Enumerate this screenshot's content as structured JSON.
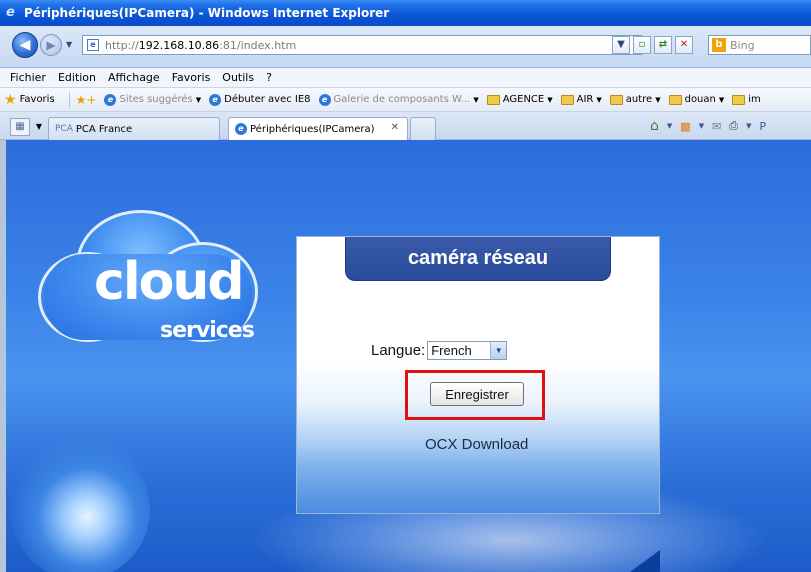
{
  "window": {
    "title": "Périphériques(IPCamera) - Windows Internet Explorer"
  },
  "address_bar": {
    "url_prefix": "http://",
    "url_host": "192.168.10.86",
    "url_suffix": ":81/index.htm",
    "search_placeholder": "Bing"
  },
  "menu": {
    "items": [
      "Fichier",
      "Edition",
      "Affichage",
      "Favoris",
      "Outils",
      "?"
    ]
  },
  "favorites_bar": {
    "favorites_label": "Favoris",
    "items": [
      {
        "label": "Sites suggérés",
        "dropdown": true,
        "muted": true
      },
      {
        "label": "Débuter avec IE8",
        "dropdown": false,
        "muted": false
      },
      {
        "label": "Galerie de composants W...",
        "dropdown": true,
        "muted": true
      },
      {
        "label": "AGENCE",
        "dropdown": true,
        "folder": true
      },
      {
        "label": "AIR",
        "dropdown": true,
        "folder": true
      },
      {
        "label": "autre",
        "dropdown": true,
        "folder": true
      },
      {
        "label": "douan",
        "dropdown": true,
        "folder": true
      },
      {
        "label": "im",
        "dropdown": false,
        "folder": true
      }
    ]
  },
  "tabs": [
    {
      "prefix": "PCA",
      "label": "PCA France",
      "active": false
    },
    {
      "label": "Périphériques(IPCamera)",
      "active": true
    }
  ],
  "command_bar": {
    "page_label": "P"
  },
  "page": {
    "logo_main": "cloud",
    "logo_sub": "services",
    "panel_title": "caméra réseau",
    "language_label": "Langue:",
    "language_selected": "French",
    "save_button": "Enregistrer",
    "ocx_link": "OCX Download"
  },
  "colors": {
    "titlebar": "#0b55d8",
    "panel_header": "#2a4c9c",
    "highlight": "#e01010",
    "page_background": "#3b82e8"
  }
}
